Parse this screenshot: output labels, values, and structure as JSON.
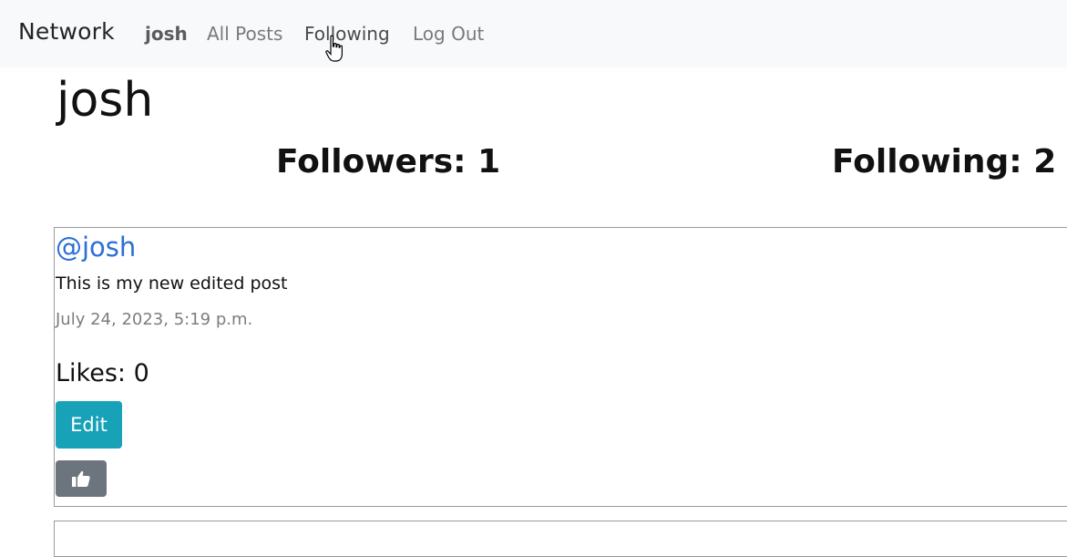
{
  "nav": {
    "brand": "Network",
    "user": "josh",
    "all_posts": "All Posts",
    "following": "Following",
    "logout": "Log Out"
  },
  "profile": {
    "name": "josh",
    "followers_label": "Followers: 1",
    "following_label": "Following: 2"
  },
  "posts": [
    {
      "author": "@josh",
      "content": "This is my new edited post",
      "timestamp": "July 24, 2023, 5:19 p.m.",
      "likes_label": "Likes: 0",
      "edit_label": "Edit",
      "like_icon": "thumbs-up-icon"
    }
  ],
  "colors": {
    "navbar_bg": "#f8f9fa",
    "link_blue": "#2b6fd6",
    "edit_button": "#17a2b8",
    "like_button": "#6c757d"
  }
}
